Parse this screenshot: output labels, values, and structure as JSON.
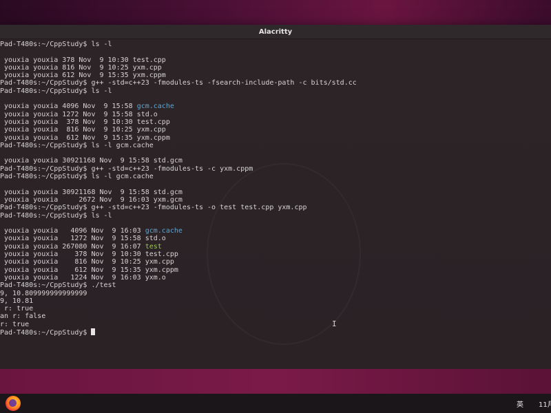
{
  "window": {
    "title": "Alacritty"
  },
  "terminal": {
    "lines": [
      [
        {
          "t": "Pad-T480s:~/CppStudy$ ls -l",
          "c": ""
        }
      ],
      [
        {
          "t": "",
          "c": ""
        }
      ],
      [
        {
          "t": " youxia youxia 378 Nov  9 10:30 test.cpp",
          "c": ""
        }
      ],
      [
        {
          "t": " youxia youxia 816 Nov  9 10:25 yxm.cpp",
          "c": ""
        }
      ],
      [
        {
          "t": " youxia youxia 612 Nov  9 15:35 yxm.cppm",
          "c": ""
        }
      ],
      [
        {
          "t": "Pad-T480s:~/CppStudy$ g++ -std=c++23 -fmodules-ts -fsearch-include-path -c bits/std.cc",
          "c": ""
        }
      ],
      [
        {
          "t": "Pad-T480s:~/CppStudy$ ls -l",
          "c": ""
        }
      ],
      [
        {
          "t": "",
          "c": ""
        }
      ],
      [
        {
          "t": " youxia youxia 4096 Nov  9 15:58 ",
          "c": ""
        },
        {
          "t": "gcm.cache",
          "c": "dir"
        }
      ],
      [
        {
          "t": " youxia youxia 1272 Nov  9 15:58 std.o",
          "c": ""
        }
      ],
      [
        {
          "t": " youxia youxia  378 Nov  9 10:30 test.cpp",
          "c": ""
        }
      ],
      [
        {
          "t": " youxia youxia  816 Nov  9 10:25 yxm.cpp",
          "c": ""
        }
      ],
      [
        {
          "t": " youxia youxia  612 Nov  9 15:35 yxm.cppm",
          "c": ""
        }
      ],
      [
        {
          "t": "Pad-T480s:~/CppStudy$ ls -l gcm.cache",
          "c": ""
        }
      ],
      [
        {
          "t": "",
          "c": ""
        }
      ],
      [
        {
          "t": " youxia youxia 30921168 Nov  9 15:58 std.gcm",
          "c": ""
        }
      ],
      [
        {
          "t": "Pad-T480s:~/CppStudy$ g++ -std=c++23 -fmodules-ts -c yxm.cppm",
          "c": ""
        }
      ],
      [
        {
          "t": "Pad-T480s:~/CppStudy$ ls -l gcm.cache",
          "c": ""
        }
      ],
      [
        {
          "t": "",
          "c": ""
        }
      ],
      [
        {
          "t": " youxia youxia 30921168 Nov  9 15:58 std.gcm",
          "c": ""
        }
      ],
      [
        {
          "t": " youxia youxia     2672 Nov  9 16:03 yxm.gcm",
          "c": ""
        }
      ],
      [
        {
          "t": "Pad-T480s:~/CppStudy$ g++ -std=c++23 -fmodules-ts -o test test.cpp yxm.cpp",
          "c": ""
        }
      ],
      [
        {
          "t": "Pad-T480s:~/CppStudy$ ls -l",
          "c": ""
        }
      ],
      [
        {
          "t": "",
          "c": ""
        }
      ],
      [
        {
          "t": " youxia youxia   4096 Nov  9 16:03 ",
          "c": ""
        },
        {
          "t": "gcm.cache",
          "c": "dir"
        }
      ],
      [
        {
          "t": " youxia youxia   1272 Nov  9 15:58 std.o",
          "c": ""
        }
      ],
      [
        {
          "t": " youxia youxia 267080 Nov  9 16:07 ",
          "c": ""
        },
        {
          "t": "test",
          "c": "exe"
        }
      ],
      [
        {
          "t": " youxia youxia    378 Nov  9 10:30 test.cpp",
          "c": ""
        }
      ],
      [
        {
          "t": " youxia youxia    816 Nov  9 10:25 yxm.cpp",
          "c": ""
        }
      ],
      [
        {
          "t": " youxia youxia    612 Nov  9 15:35 yxm.cppm",
          "c": ""
        }
      ],
      [
        {
          "t": " youxia youxia   1224 Nov  9 16:03 yxm.o",
          "c": ""
        }
      ],
      [
        {
          "t": "Pad-T480s:~/CppStudy$ ./test",
          "c": ""
        }
      ],
      [
        {
          "t": "9, 10.809999999999999",
          "c": ""
        }
      ],
      [
        {
          "t": "9, 10.81",
          "c": ""
        }
      ],
      [
        {
          "t": " r: true",
          "c": ""
        }
      ],
      [
        {
          "t": "an r: false",
          "c": ""
        }
      ],
      [
        {
          "t": "r: true",
          "c": ""
        }
      ],
      [
        {
          "t": "Pad-T480s:~/CppStudy$ ",
          "c": "",
          "cursor": true
        }
      ]
    ],
    "colors": {
      "directory": "#5aa8d6",
      "executable": "#9bcb4a",
      "foreground": "#d8d4d6",
      "background": "#2a2225"
    }
  },
  "taskbar": {
    "app_icon": "firefox-icon",
    "ime_label": "英",
    "clock_text": "11月"
  }
}
